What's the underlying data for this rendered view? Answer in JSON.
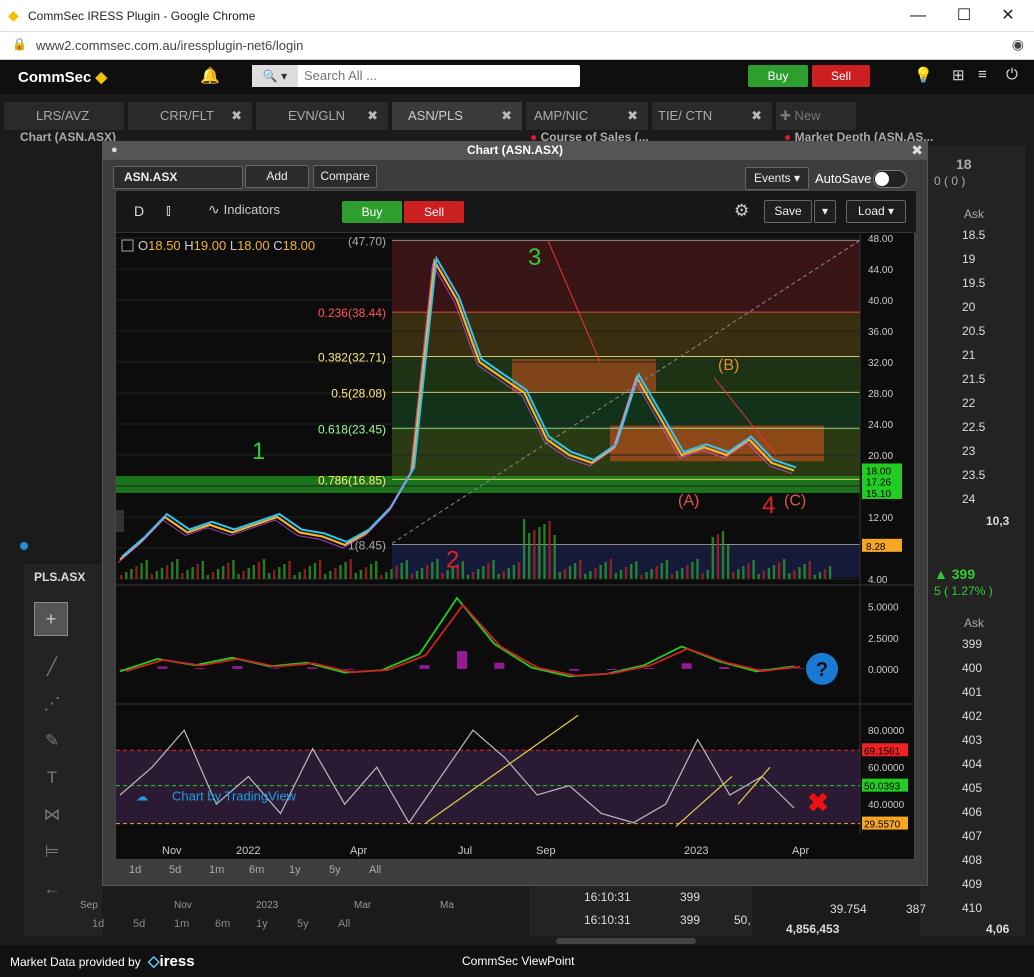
{
  "browser": {
    "title": "CommSec IRESS Plugin - Google Chrome",
    "url": "www2.commsec.com.au/iressplugin-net6/login"
  },
  "app": {
    "logo": "CommSec",
    "search_placeholder": "Search All ...",
    "buy": "Buy",
    "sell": "Sell"
  },
  "tabs": [
    {
      "label": "LRS/AVZ"
    },
    {
      "label": "CRR/FLT"
    },
    {
      "label": "EVN/GLN"
    },
    {
      "label": "ASN/PLS"
    },
    {
      "label": "AMP/NIC"
    },
    {
      "label": "TIE/ CTN"
    },
    {
      "label": "New"
    }
  ],
  "panes": {
    "chart": "Chart (ASN.ASX)",
    "course": "Course of Sales (...",
    "depth": "Market Depth (ASN.AS..."
  },
  "depth": {
    "price": "18",
    "change": "0 ( 0 )",
    "ask_hdr": "Ask",
    "asks": [
      "18.5",
      "19",
      "19.5",
      "20",
      "20.5",
      "21",
      "21.5",
      "22",
      "22.5",
      "23",
      "23.5",
      "24"
    ],
    "total": "10,3",
    "price2": "399",
    "change2": "5 ( 1.27% )",
    "asks2": [
      "399",
      "400",
      "401",
      "402",
      "403",
      "404",
      "405",
      "406",
      "407",
      "408",
      "409",
      "410"
    ],
    "row_a": "39.754",
    "row_b": "387",
    "total2": "4,856,453",
    "total2b": "4,06"
  },
  "course_rows": [
    {
      "t": "16:10:31",
      "p": "399",
      "v": ""
    },
    {
      "t": "16:10:31",
      "p": "399",
      "v": "50,"
    }
  ],
  "bgchart": {
    "symbol": "PLS.ASX",
    "labels": [
      "Sep",
      "Nov",
      "2023",
      "Mar",
      "Ma"
    ],
    "periods": [
      "1d",
      "5d",
      "1m",
      "6m",
      "1y",
      "5y",
      "All"
    ]
  },
  "chartwin": {
    "title": "Chart (ASN.ASX)",
    "symbol": "ASN.ASX",
    "add": "Add",
    "compare": "Compare",
    "events": "Events",
    "autosave": "AutoSave",
    "interval": "D",
    "indicators": "Indicators",
    "buy": "Buy",
    "sell": "Sell",
    "save": "Save",
    "load": "Load",
    "ohlc": {
      "o": "O",
      "o_v": "18.50",
      "h": "H",
      "h_v": "19.00",
      "l": "L",
      "l_v": "18.00",
      "c": "C",
      "c_v": "18.00"
    },
    "attribution": "Chart by TradingView",
    "periods": [
      "1d",
      "5d",
      "1m",
      "6m",
      "1y",
      "5y",
      "All"
    ]
  },
  "footer": {
    "left": "Market Data provided by",
    "brand": "iress",
    "center": "CommSec ViewPoint"
  },
  "chart_data": [
    {
      "type": "line",
      "title": "",
      "xlabel": "",
      "ylabel": "",
      "x_ticks": [
        "Nov",
        "2022",
        "Apr",
        "Jul",
        "Sep",
        "2023",
        "Apr"
      ],
      "y_ticks": [
        4,
        8,
        12,
        16,
        20,
        24,
        28,
        32,
        36,
        40,
        44,
        48
      ],
      "ylim": [
        4,
        48
      ],
      "series": [
        {
          "values": [
            6.5,
            9,
            12,
            10,
            11,
            10,
            11,
            12,
            10,
            9.5,
            8.4,
            10,
            13,
            18,
            45,
            40,
            32,
            30,
            28,
            22,
            20,
            19,
            21,
            30,
            25,
            20,
            21,
            20,
            22,
            19,
            18
          ]
        }
      ],
      "current_price": "18.00",
      "price_labels": [
        "18.00",
        "17.26",
        "15.10",
        "8.28"
      ],
      "fib_levels": [
        {
          "label": "0.236(38.44)",
          "v": 38.44
        },
        {
          "label": "0.382(32.71)",
          "v": 32.71
        },
        {
          "label": "0.5(28.08)",
          "v": 28.08
        },
        {
          "label": "0.618(23.45)",
          "v": 23.45
        },
        {
          "label": "0.786(16.85)",
          "v": 16.85
        },
        {
          "label": "1(8.45)",
          "v": 8.45
        },
        {
          "label": "(47.70)",
          "v": 47.7
        }
      ],
      "wave_labels": [
        "1",
        "2",
        "3",
        "(A)",
        "(B)",
        "(C)",
        "4"
      ]
    },
    {
      "type": "line",
      "title": "",
      "y_ticks": [
        "5.0000",
        "2.5000",
        "0.0000"
      ],
      "ylim": [
        -2.5,
        6.5
      ],
      "series": [
        {
          "values": [
            -0.2,
            0.8,
            0.3,
            0.9,
            0.2,
            0.5,
            -0.3,
            -0.1,
            1.2,
            5.7,
            2,
            0.1,
            -0.6,
            -0.4,
            0.3,
            1.8,
            0.6,
            -0.2,
            0.2
          ]
        }
      ]
    },
    {
      "type": "line",
      "title": "",
      "y_ticks": [
        "80.0000",
        "60.0000",
        "40.0000"
      ],
      "ylim": [
        25,
        92
      ],
      "levels": [
        "69.1561",
        "50.0393",
        "29.5570"
      ],
      "series": [
        {
          "values": [
            45,
            60,
            80,
            40,
            55,
            35,
            70,
            40,
            60,
            30,
            55,
            80,
            65,
            45,
            50,
            35,
            30,
            40,
            75,
            45,
            55,
            38
          ]
        }
      ]
    }
  ]
}
